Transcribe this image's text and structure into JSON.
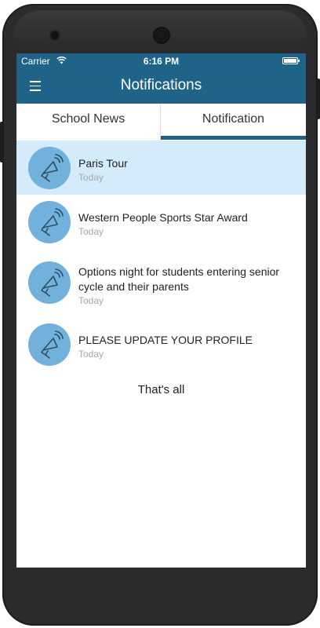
{
  "status_bar": {
    "carrier": "Carrier",
    "time": "6:16 PM"
  },
  "nav": {
    "title": "Notifications",
    "menu_icon": "hamburger-menu-icon"
  },
  "tabs": [
    {
      "label": "School News",
      "active": false
    },
    {
      "label": "Notification",
      "active": true
    }
  ],
  "notifications": [
    {
      "title": "Paris Tour",
      "time": "Today",
      "selected": true,
      "icon": "megaphone-icon"
    },
    {
      "title": "Western People Sports Star Award",
      "time": "Today",
      "selected": false,
      "icon": "megaphone-icon"
    },
    {
      "title": "Options night for students entering senior cycle and their parents",
      "time": "Today",
      "selected": false,
      "icon": "megaphone-icon"
    },
    {
      "title": "PLEASE UPDATE YOUR PROFILE",
      "time": "Today",
      "selected": false,
      "icon": "megaphone-icon"
    }
  ],
  "footer": {
    "text": "That's all"
  },
  "colors": {
    "accent": "#1f6488",
    "selected_row": "#d3ebfa",
    "icon_circle": "#71b1dc"
  }
}
